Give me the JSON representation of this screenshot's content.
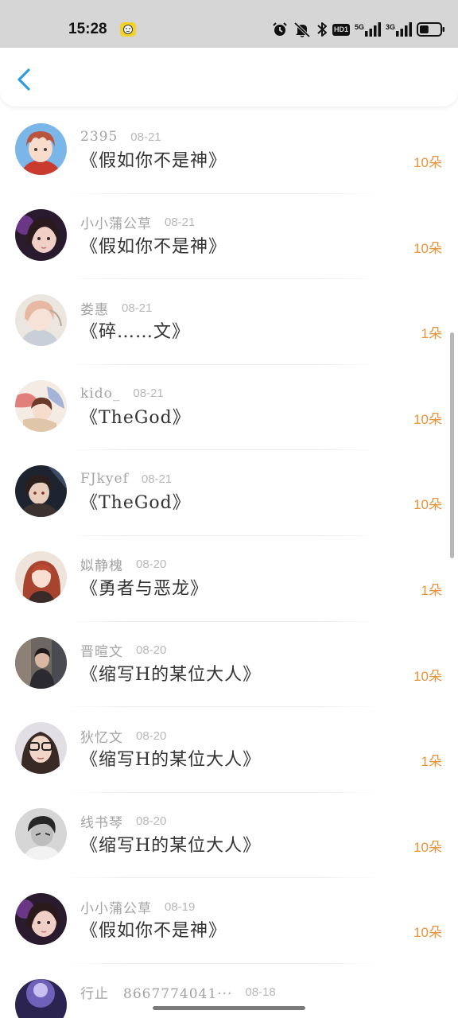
{
  "status_bar": {
    "time": "15:28",
    "app_icon": "messenger-app-icon",
    "icons": [
      "alarm-icon",
      "mute-icon",
      "bluetooth-icon",
      "hd-icon",
      "signal-5g-icon",
      "signal-3g-icon",
      "battery-icon"
    ],
    "hd_label": "HD1",
    "sim1_label": "5G",
    "sim2_label": "3G",
    "battery_level": 0.45
  },
  "header": {
    "back_icon": "chevron-left-icon",
    "accent_color": "#2f9be6"
  },
  "colors": {
    "flower_count": "#e8943a",
    "name": "#a3a3a3",
    "title": "#333333"
  },
  "list": {
    "items": [
      {
        "name": "2395",
        "date": "08-21",
        "title": "《假如你不是神》",
        "count": "10朵",
        "avatar": "avatar-anime-boy"
      },
      {
        "name": "小小蒲公草",
        "date": "08-21",
        "title": "《假如你不是神》",
        "count": "10朵",
        "avatar": "avatar-girl-purple"
      },
      {
        "name": "娄惠",
        "date": "08-21",
        "title": "《碎……文》",
        "count": "1朵",
        "avatar": "avatar-anime-sketch"
      },
      {
        "name": "kido_",
        "date": "08-21",
        "title": "《TheGod》",
        "count": "10朵",
        "avatar": "avatar-anime-colorful"
      },
      {
        "name": "FJkyef",
        "date": "08-21",
        "title": "《TheGod》",
        "count": "10朵",
        "avatar": "avatar-anime-dark"
      },
      {
        "name": "姒静槐",
        "date": "08-20",
        "title": "《勇者与恶龙》",
        "count": "1朵",
        "avatar": "avatar-anime-redhair"
      },
      {
        "name": "晋暄文",
        "date": "08-20",
        "title": "《缩写H的某位大人》",
        "count": "10朵",
        "avatar": "avatar-photo-boy"
      },
      {
        "name": "狄忆文",
        "date": "08-20",
        "title": "《缩写H的某位大人》",
        "count": "1朵",
        "avatar": "avatar-photo-glasses"
      },
      {
        "name": "线书琴",
        "date": "08-20",
        "title": "《缩写H的某位大人》",
        "count": "10朵",
        "avatar": "avatar-photo-bw"
      },
      {
        "name": "小小蒲公草",
        "date": "08-19",
        "title": "《假如你不是神》",
        "count": "10朵",
        "avatar": "avatar-girl-purple"
      },
      {
        "name": "行止　8667774041···",
        "date": "08-18",
        "title": "",
        "count": "",
        "avatar": "avatar-purple-glow"
      }
    ]
  }
}
